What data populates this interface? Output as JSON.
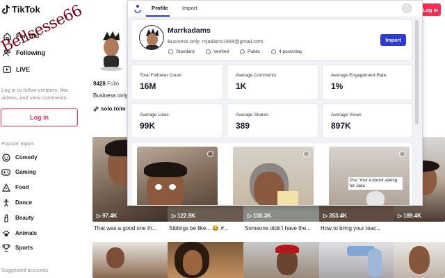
{
  "sidebar": {
    "logo_text": "TikTok",
    "nav": [
      {
        "label": "For You",
        "icon": "home-icon"
      },
      {
        "label": "Following",
        "icon": "users-icon"
      },
      {
        "label": "LIVE",
        "icon": "live-icon"
      }
    ],
    "login_hint": "Log in to follow creators, like videos, and view comments.",
    "login_button": "Log in",
    "topics_title": "Popular topics",
    "topics": [
      {
        "label": "Comedy",
        "icon": "smile-icon"
      },
      {
        "label": "Gaming",
        "icon": "gamepad-icon"
      },
      {
        "label": "Food",
        "icon": "food-icon"
      },
      {
        "label": "Dance",
        "icon": "dance-icon"
      },
      {
        "label": "Beauty",
        "icon": "beauty-icon"
      },
      {
        "label": "Animals",
        "icon": "paw-icon"
      },
      {
        "label": "Sports",
        "icon": "trophy-icon"
      }
    ],
    "suggested_title": "Suggested accounts",
    "watermark": "Bellsesse66"
  },
  "profile_bg": {
    "following_count": "9428",
    "following_label": "Follo",
    "bio": "Business only",
    "link": "solo.to/m"
  },
  "topbar": {
    "login": "Log in"
  },
  "videos_row1": [
    {
      "views": "97.4K",
      "caption": "That was a good one th..."
    },
    {
      "views": "122.9K",
      "caption": "Siblings be like... 😂 #..."
    },
    {
      "views": "100.3K",
      "caption": "Someone didn't have the..."
    },
    {
      "views": "353.4K",
      "caption": "How to bring your teac..."
    },
    {
      "views": "189.4K",
      "caption": ""
    }
  ],
  "popup": {
    "tabs": [
      "Profile",
      "Import"
    ],
    "active_tab": "Profile",
    "profile": {
      "name": "Marrkadams",
      "business": "Business only: mjadams1994@gmail.com",
      "badges": [
        "Standard",
        "Verified",
        "Public",
        "4 posts/day"
      ],
      "import_button": "Import"
    },
    "stats": [
      {
        "label": "Total Follower Count",
        "value": "16M"
      },
      {
        "label": "Average Comments",
        "value": "1K"
      },
      {
        "label": "Average Engagement Rate",
        "value": "1%"
      },
      {
        "label": "Average Likes",
        "value": "99K"
      },
      {
        "label": "Average Shares",
        "value": "389"
      },
      {
        "label": "Average Views",
        "value": "897K"
      }
    ],
    "thumb_overlay": "Pov: Your a doctor asking for Jada"
  },
  "colors": {
    "brand": "#fe2c55",
    "accent": "#2d3bd6"
  }
}
